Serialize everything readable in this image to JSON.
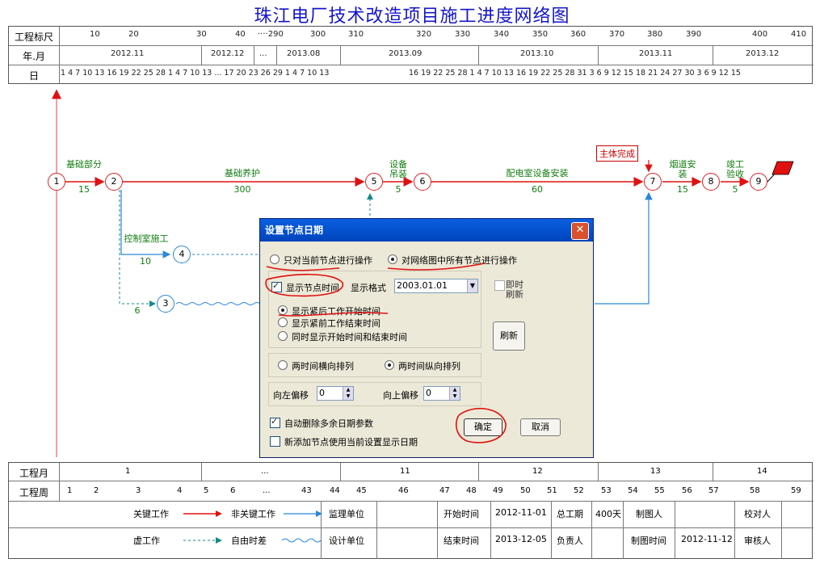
{
  "title": "珠江电厂技术改造项目施工进度网络图",
  "header": {
    "row_labels": [
      "工程标尺",
      "年.月",
      "日"
    ],
    "scale_ticks": [
      "10",
      "20",
      "30",
      "40",
      "····290",
      "300",
      "310",
      "320",
      "330",
      "340",
      "350",
      "360",
      "370",
      "380",
      "390",
      "400",
      "410"
    ],
    "months": [
      "2012.11",
      "2012.12",
      "...",
      "2013.08",
      "2013.09",
      "2013.10",
      "2013.11",
      "2013.12"
    ],
    "days_a": "1  4  7 10 13 16     19     22 25 28  1  4  7 10 13 ... 17 20 23 26 29  1  4  7 10 13",
    "days_b": "16     19 22 25 28  1  4  7 10 13 16 19 22 25 28 31  3  6  9 12 15 18 21 24 27 30     3     6  9 12 15"
  },
  "network": {
    "nodes": [
      "1",
      "2",
      "3",
      "4",
      "5",
      "6",
      "7",
      "8",
      "9"
    ],
    "activities": [
      {
        "name": "基础部分",
        "duration": "15"
      },
      {
        "name": "基础养护",
        "duration": "300"
      },
      {
        "name": "设备吊装",
        "duration": "5"
      },
      {
        "name": "配电室设备安装",
        "duration": "60"
      },
      {
        "name": "烟道安装",
        "duration": "15"
      },
      {
        "name": "竣工验收",
        "duration": "5"
      },
      {
        "name": "控制室施工",
        "duration": "10"
      },
      {
        "name": "",
        "duration": "6"
      }
    ],
    "milestone": "主体完成"
  },
  "dialog": {
    "title": "设置节点日期",
    "close": "✕",
    "radio_current": "只对当前节点进行操作",
    "radio_all": "对网络图中所有节点进行操作",
    "show_time": "显示节点时间",
    "format_label": "显示格式",
    "format_value": "2003.01.01",
    "instant_refresh": "即时刷新",
    "opt_start": "显示紧后工作开始时间",
    "opt_end": "显示紧前工作结束时间",
    "opt_both": "同时显示开始时间和结束时间",
    "refresh": "刷新",
    "horiz": "两时间横向排列",
    "vert": "两时间纵向排列",
    "left_offset": "向左偏移",
    "up_offset": "向上偏移",
    "left_value": "0",
    "up_value": "0",
    "auto_delete": "自动删除多余日期参数",
    "new_node": "新添加节点使用当前设置显示日期",
    "ok": "确定",
    "cancel": "取消"
  },
  "footer": {
    "month_label": "工程月",
    "week_label": "工程周",
    "months": [
      "1",
      "...",
      "11",
      "12",
      "13",
      "14"
    ],
    "weeks": [
      "1",
      "2",
      "3",
      "4",
      "5",
      "6",
      "...",
      "43",
      "44",
      "45",
      "46",
      "47",
      "48",
      "49",
      "50",
      "51",
      "52",
      "53",
      "54",
      "55",
      "56",
      "57",
      "58",
      "59"
    ],
    "legend": {
      "critical": "关键工作",
      "noncritical": "非关键工作",
      "dummy": "虚工作",
      "float": "自由时差"
    },
    "info": {
      "supervisor": "监理单位",
      "designer": "设计单位",
      "start_label": "开始时间",
      "start_value": "2012-11-01",
      "end_label": "结束时间",
      "end_value": "2013-12-05",
      "total_label": "总工期",
      "total_value": "400天",
      "owner_label": "负责人",
      "drawer_label": "制图人",
      "draw_time_label": "制图时间",
      "draw_time_value": "2012-11-12",
      "checker_label": "校对人",
      "reviewer_label": "审核人"
    }
  }
}
